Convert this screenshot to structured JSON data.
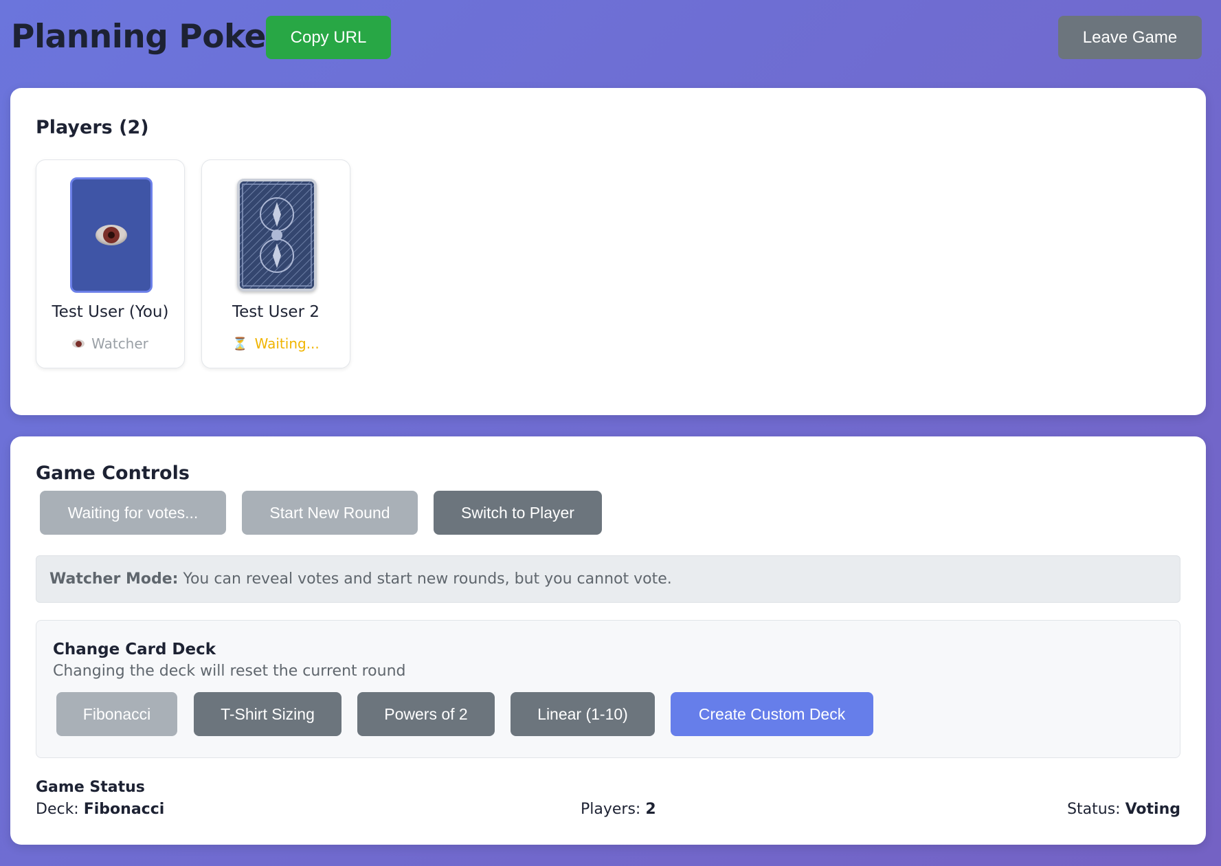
{
  "header": {
    "title": "Planning Poker",
    "copy_url_label": "Copy URL",
    "leave_game_label": "Leave Game"
  },
  "players": {
    "title": "Players (2)",
    "items": [
      {
        "name": "Test User (You)",
        "status": "Watcher",
        "status_icon": "eye-icon",
        "card": "watcher-card"
      },
      {
        "name": "Test User 2",
        "status": "Waiting...",
        "status_icon": "hourglass-icon",
        "card": "card-back"
      }
    ]
  },
  "controls": {
    "title": "Game Controls",
    "buttons": [
      "Waiting for votes...",
      "Start New Round",
      "Switch to Player"
    ],
    "watcher_note_label": "Watcher Mode:",
    "watcher_note_text": "You can reveal votes and start new rounds, but you cannot vote."
  },
  "deck": {
    "title": "Change Card Deck",
    "subtitle": "Changing the deck will reset the current round",
    "options": [
      "Fibonacci",
      "T-Shirt Sizing",
      "Powers of 2",
      "Linear (1-10)"
    ],
    "selected": "Fibonacci",
    "custom_label": "Create Custom Deck"
  },
  "status": {
    "title": "Game Status",
    "deck_label": "Deck:",
    "deck_value": "Fibonacci",
    "players_label": "Players:",
    "players_value": "2",
    "status_label": "Status:",
    "status_value": "Voting"
  },
  "colors": {
    "copy_button": "#28a745",
    "secondary_button": "#6c757d",
    "disabled_button": "#a9b0b7",
    "accent": "#667eea",
    "waiting": "#f0b400"
  }
}
